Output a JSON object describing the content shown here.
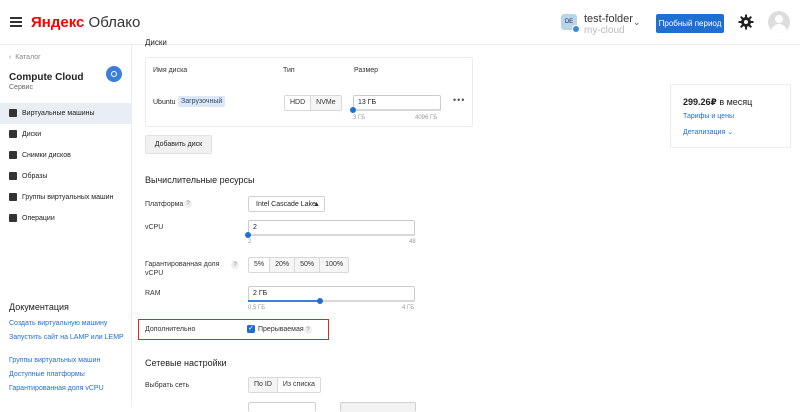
{
  "header": {
    "logo_brand": "Яндекс",
    "logo_product": "Облако",
    "folder_initials": "DE",
    "folder_name": "test-folder",
    "folder_cloud": "my-cloud",
    "trial_button": "Пробный период"
  },
  "sidebar": {
    "back": "Каталог",
    "service_title": "Compute Cloud",
    "service_subtitle": "Сервис",
    "items": [
      {
        "label": "Виртуальные машины",
        "icon": "vm-icon"
      },
      {
        "label": "Диски",
        "icon": "disk-icon"
      },
      {
        "label": "Снимки дисков",
        "icon": "snapshot-icon"
      },
      {
        "label": "Образы",
        "icon": "image-icon"
      },
      {
        "label": "Группы виртуальных машин",
        "icon": "vm-group-icon"
      },
      {
        "label": "Операции",
        "icon": "operations-icon"
      }
    ],
    "docs_title": "Документация",
    "docs": [
      "Создать виртуальную машину",
      "Запустить сайт на LAMP или LEMP",
      "Группы виртуальных машин",
      "Доступные платформы",
      "Гарантированная доля vCPU"
    ]
  },
  "disks": {
    "section_title": "Диски",
    "col_name": "Имя диска",
    "col_type": "Тип",
    "col_size": "Размер",
    "disk_name": "Ubuntu",
    "boot_badge": "Загрузочный",
    "type_options": [
      "HDD",
      "NVMe"
    ],
    "size_value": "13 ГБ",
    "size_min": "3 ГБ",
    "size_max": "4096 ГБ",
    "size_fraction": 0.0024,
    "more": "•••",
    "add_button": "Добавить диск"
  },
  "compute": {
    "section_title": "Вычислительные ресурсы",
    "platform_label": "Платформа",
    "platform_value": "Intel Cascade Lake",
    "vcpu_label": "vCPU",
    "vcpu_value": "2",
    "vcpu_min": "2",
    "vcpu_max": "48",
    "vcpu_fraction": 0,
    "share_label": "Гарантированная доля vCPU",
    "share_options": [
      "5%",
      "20%",
      "50%",
      "100%"
    ],
    "ram_label": "RAM",
    "ram_value": "2 ГБ",
    "ram_min": "0.5 ГБ",
    "ram_max": "4 ГБ",
    "ram_fraction": 0.43,
    "extra_label": "Дополнительно",
    "preemptible_label": "Прерываемая",
    "preemptible_checked": true,
    "help": "?"
  },
  "network": {
    "section_title": "Сетевые настройки",
    "choose_label": "Выбрать сеть",
    "options": [
      "По ID",
      "Из списка"
    ]
  },
  "pricing": {
    "price": "299.26₽",
    "period": "в месяц",
    "link_tariffs": "Тарифы и цены",
    "link_details": "Детализация"
  }
}
